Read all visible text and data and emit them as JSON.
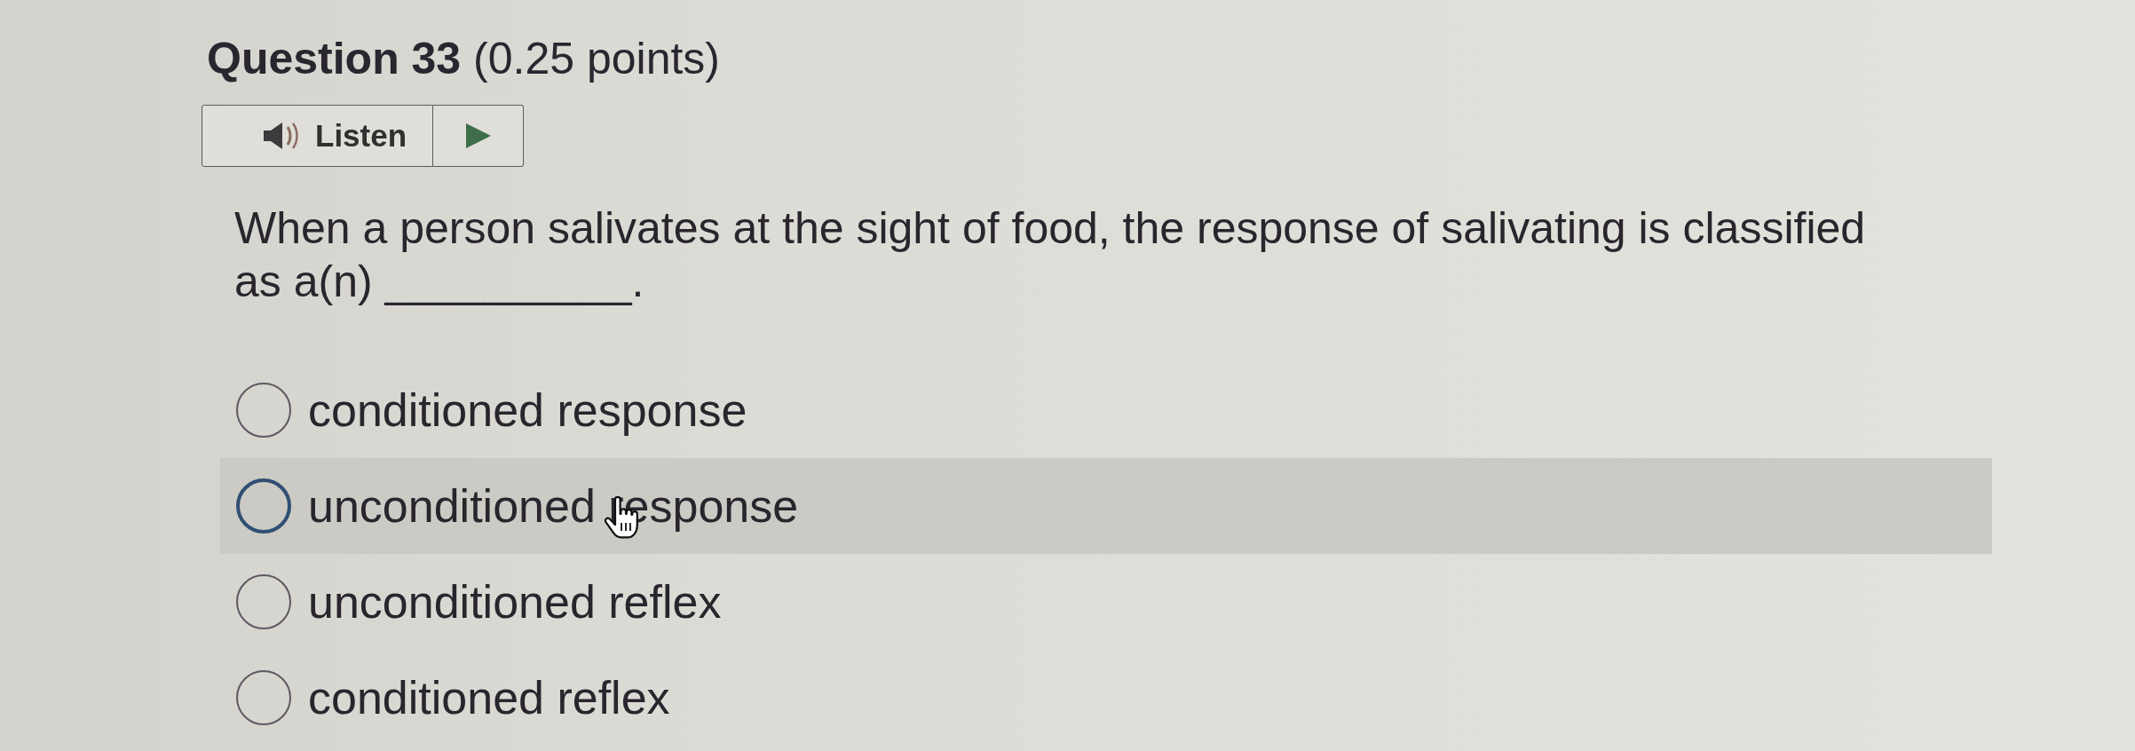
{
  "question": {
    "title": "**Question 33** (0.25 points)",
    "listen_button": {
      "label": "Listen"
    },
    "prompt": "When a person salivates at the sight of food, the response of salivating is classified as a(n) __________."
  },
  "options": [
    {
      "label": "conditioned response",
      "selected": false,
      "hovered": false
    },
    {
      "label": "unconditioned response",
      "selected": false,
      "hovered": true
    },
    {
      "label": "unconditioned reflex",
      "selected": false,
      "hovered": false
    },
    {
      "label": "conditioned reflex",
      "selected": false,
      "hovered": false
    }
  ]
}
